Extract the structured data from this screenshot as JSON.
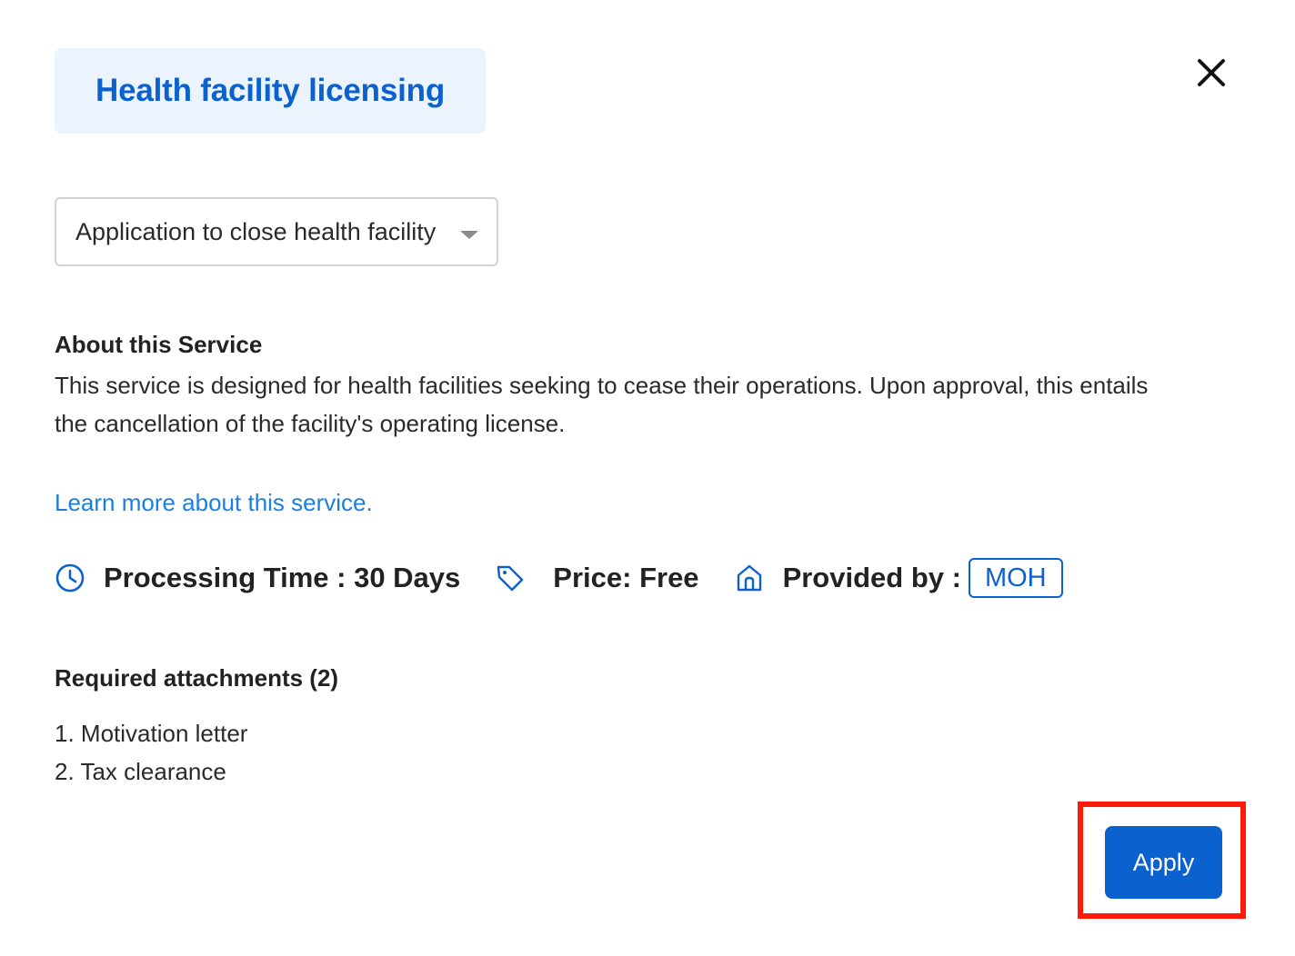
{
  "category": {
    "label": "Health facility licensing"
  },
  "close_button": {
    "icon": "close-icon"
  },
  "service_select": {
    "selected": "Application to close health facility",
    "icon": "chevron-down-icon"
  },
  "about": {
    "title": "About this Service",
    "text": "This service is designed for health facilities seeking to cease their operations. Upon approval, this entails the cancellation of the facility's operating license."
  },
  "learn_more": {
    "label": "Learn more about this service."
  },
  "meta": {
    "processing_time": {
      "icon": "clock-icon",
      "label": "Processing Time : 30 Days"
    },
    "price": {
      "icon": "price-tag-icon",
      "label": "Price: Free"
    },
    "provider": {
      "icon": "home-icon",
      "label": "Provided by :",
      "value": "MOH"
    }
  },
  "attachments": {
    "title": "Required attachments (2)",
    "items": [
      "1. Motivation letter",
      "2. Tax clearance"
    ]
  },
  "actions": {
    "apply_label": "Apply"
  },
  "colors": {
    "primary": "#0b62cf",
    "link": "#1a7fe0",
    "badge_bg": "#ebf3fd",
    "highlight": "#ff1a0a"
  }
}
